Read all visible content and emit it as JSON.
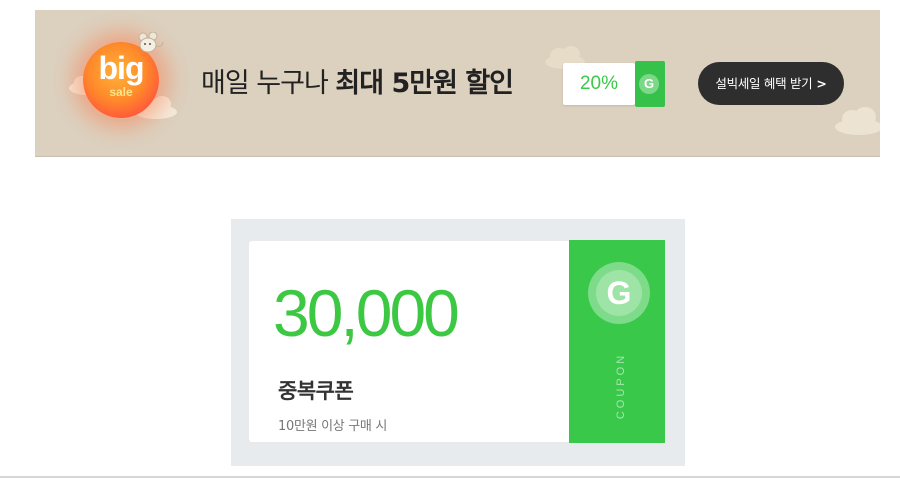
{
  "banner": {
    "logo_big": "big",
    "logo_sale": "sale",
    "headline_part1": "매일 누구나 ",
    "headline_part2": "최대 5만원",
    "headline_part3": " 할인",
    "mini_coupon_percent": "20%",
    "mini_coupon_logo": "G",
    "cta_label": "설빅세일 혜택 받기",
    "cta_arrow": ">",
    "background_color": "#dcd1bf",
    "icons": [
      "cloud-icon",
      "mouse-icon"
    ]
  },
  "coupon": {
    "amount": "30,000",
    "title": "중복쿠폰",
    "condition": "10만원 이상 구매 시",
    "stub_logo": "G",
    "stub_label": "COUPON",
    "accent_color": "#3dc843",
    "panel_color": "#e7ebee"
  }
}
